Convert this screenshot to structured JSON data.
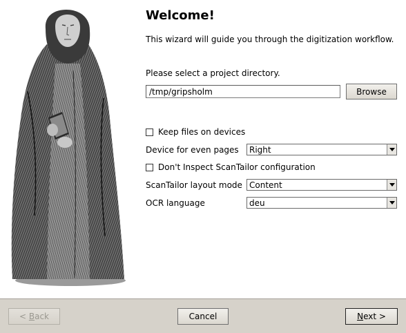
{
  "heading": "Welcome!",
  "intro": "This wizard will guide you through the digitization workflow.",
  "project": {
    "label": "Please select a project directory.",
    "path": "/tmp/gripsholm",
    "browse_label": "Browse"
  },
  "options": {
    "keep_files_label": "Keep files on devices",
    "keep_files_checked": false,
    "even_pages_label": "Device for even pages",
    "even_pages_value": "Right",
    "dont_inspect_label": "Don't Inspect ScanTailor configuration",
    "dont_inspect_checked": false,
    "layout_mode_label": "ScanTailor layout mode",
    "layout_mode_value": "Content",
    "ocr_label": "OCR language",
    "ocr_value": "deu"
  },
  "footer": {
    "back_prefix": "< ",
    "back_key": "B",
    "back_rest": "ack",
    "cancel_label": "Cancel",
    "next_key": "N",
    "next_rest": "ext >"
  },
  "colors": {
    "footer_bg": "#d6d2ca",
    "disabled_text": "#9a9890"
  }
}
